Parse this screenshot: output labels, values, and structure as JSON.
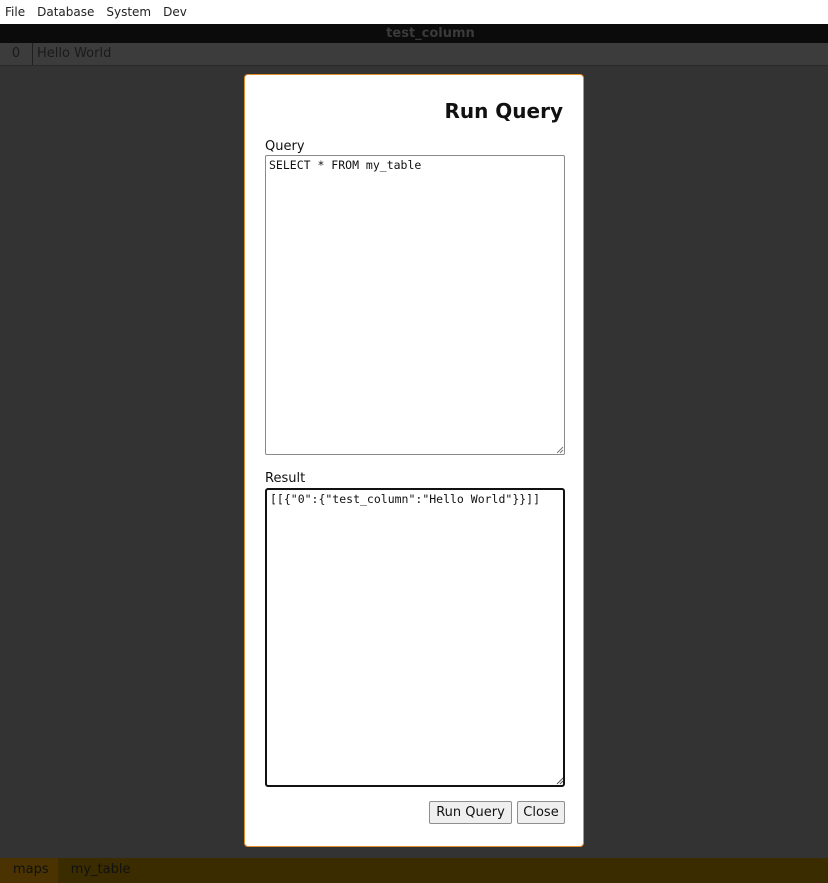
{
  "menubar": {
    "items": [
      {
        "label": "File"
      },
      {
        "label": "Database"
      },
      {
        "label": "System"
      },
      {
        "label": "Dev"
      }
    ]
  },
  "grid": {
    "column_header": "test_column",
    "rows": [
      {
        "index": "0",
        "value": "Hello World"
      }
    ]
  },
  "modal": {
    "title": "Run Query",
    "query_label": "Query",
    "query_value": "SELECT * FROM my_table",
    "result_label": "Result",
    "result_value": "[[{\"0\":{\"test_column\":\"Hello World\"}}]]",
    "run_button": "Run Query",
    "close_button": "Close",
    "accent_color": "#e08f2a"
  },
  "bottom_tabs": {
    "tabs": [
      {
        "label": "maps"
      },
      {
        "label": "my_table"
      }
    ]
  }
}
